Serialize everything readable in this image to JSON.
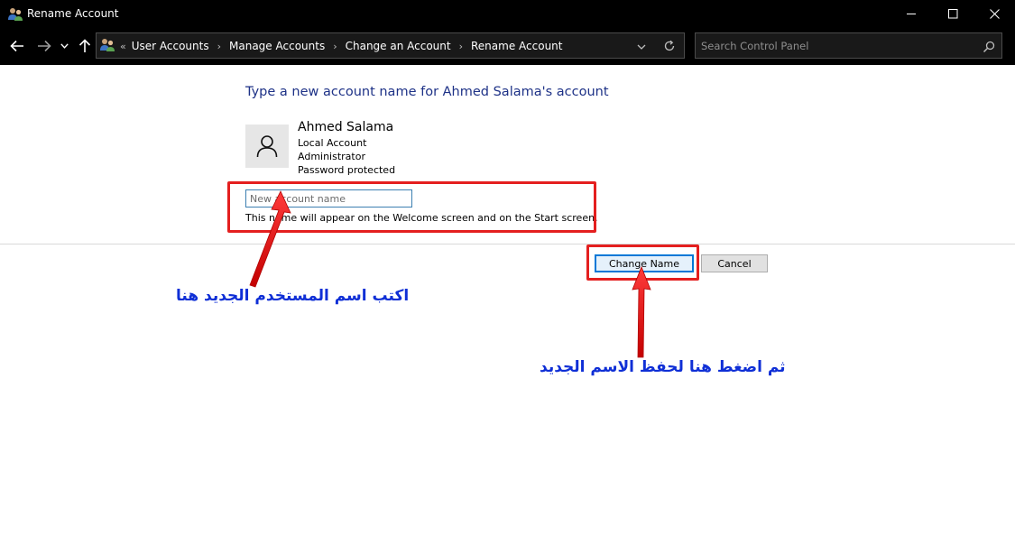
{
  "window": {
    "title": "Rename Account"
  },
  "navigation": {
    "breadcrumb_lead": "«",
    "breadcrumbs": [
      "User Accounts",
      "Manage Accounts",
      "Change an Account",
      "Rename Account"
    ],
    "search_placeholder": "Search Control Panel"
  },
  "content": {
    "heading": "Type a new account name for Ahmed Salama's account",
    "account": {
      "name": "Ahmed Salama",
      "type": "Local Account",
      "role": "Administrator",
      "security": "Password protected"
    },
    "new_name_placeholder": "New account name",
    "new_name_value": "",
    "hint": "This name will appear on the Welcome screen and on the Start screen.",
    "change_button": "Change Name",
    "cancel_button": "Cancel"
  },
  "annotations": {
    "type_name_here": "اكتب اسم المستخدم الجديد هنا",
    "click_to_save": "ثم اضغط هنا لحفظ الاسم الجديد"
  },
  "colors": {
    "chrome": "#000000",
    "heading": "#1e3287",
    "annotation_box": "#e41f1f",
    "annotation_text": "#0f2fd6",
    "focus": "#0078d7"
  },
  "icons": {
    "window": "user-accounts-icon",
    "back": "arrow-left-icon",
    "forward": "arrow-right-icon",
    "recent": "chevron-down-icon",
    "up": "arrow-up-icon",
    "refresh": "refresh-icon",
    "search": "search-icon",
    "avatar": "user-silhouette-icon"
  }
}
